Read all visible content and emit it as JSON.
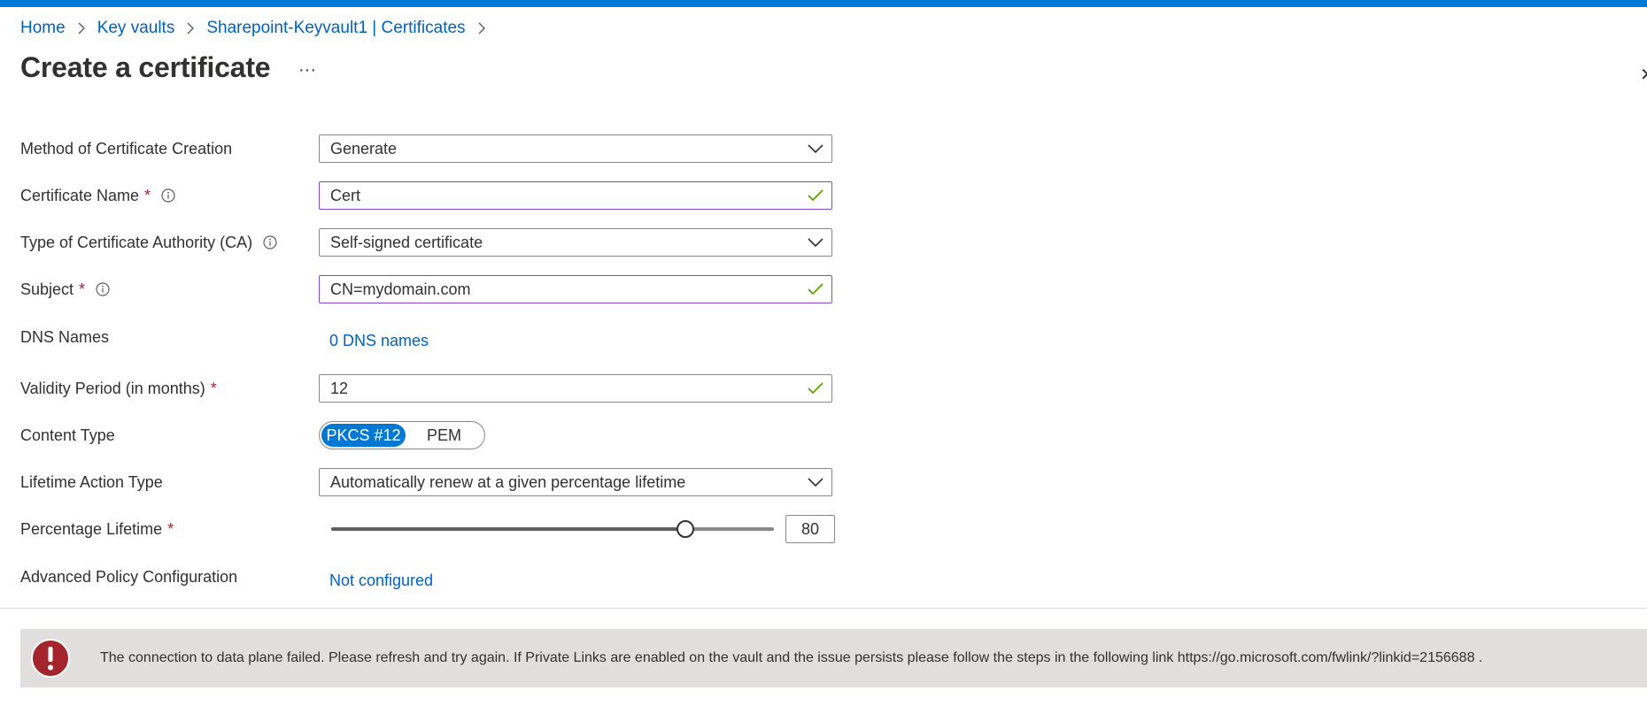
{
  "breadcrumb": [
    "Home",
    "Key vaults",
    "Sharepoint-Keyvault1 | Certificates"
  ],
  "page": {
    "title": "Create a certificate",
    "more_label": "···"
  },
  "form": {
    "method": {
      "label": "Method of Certificate Creation",
      "value": "Generate"
    },
    "cert_name": {
      "label": "Certificate Name",
      "value": "Cert",
      "required_mark": "*"
    },
    "ca_type": {
      "label": "Type of Certificate Authority (CA)",
      "value": "Self-signed certificate"
    },
    "subject": {
      "label": "Subject",
      "value": "CN=mydomain.com",
      "required_mark": "*"
    },
    "dns": {
      "label": "DNS Names",
      "link": "0 DNS names"
    },
    "validity": {
      "label": "Validity Period (in months)",
      "value": "12",
      "required_mark": "*"
    },
    "content_type": {
      "label": "Content Type",
      "options": [
        "PKCS #12",
        "PEM"
      ],
      "selected": "PKCS #12"
    },
    "lifetime_action": {
      "label": "Lifetime Action Type",
      "value": "Automatically renew at a given percentage lifetime"
    },
    "percentage": {
      "label": "Percentage Lifetime",
      "value": "80",
      "required_mark": "*",
      "slider_fraction": 0.8
    },
    "advanced": {
      "label": "Advanced Policy Configuration",
      "link": "Not configured"
    }
  },
  "error": {
    "message": "The connection to data plane failed. Please refresh and try again. If Private Links are enabled on the vault and the issue persists please follow the steps in the following link https://go.microsoft.com/fwlink/?linkid=2156688 ."
  },
  "colors": {
    "accent": "#0078d4",
    "link": "#0062bd",
    "required": "#a4262c",
    "valid_check": "#57a300",
    "valid_border": "#8a46c8",
    "error_icon": "#a4262c",
    "banner_bg": "#e1dfdd"
  },
  "icons": {
    "chevron": "chevron-right-icon",
    "dropdown": "chevron-down-icon",
    "info": "info-icon",
    "check": "checkmark-icon",
    "error": "error-icon"
  }
}
